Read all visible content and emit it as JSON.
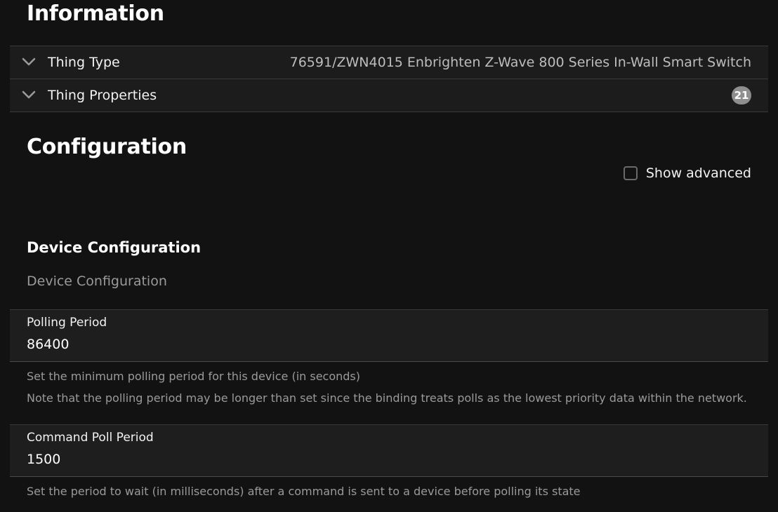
{
  "information": {
    "heading": "Information",
    "rows": [
      {
        "title": "Thing Type",
        "value": "76591/ZWN4015 Enbrighten Z-Wave 800 Series In-Wall Smart Switch",
        "icon": "chevron-down-icon"
      },
      {
        "title": "Thing Properties",
        "badge": "21",
        "icon": "chevron-down-icon"
      }
    ]
  },
  "configuration": {
    "heading": "Configuration",
    "show_advanced": {
      "label": "Show advanced",
      "checked": false
    }
  },
  "device_configuration": {
    "title": "Device Configuration",
    "description": "Device Configuration",
    "fields": [
      {
        "label": "Polling Period",
        "value": "86400",
        "help": [
          "Set the minimum polling period for this device (in seconds)",
          "Note that the polling period may be longer than set since the binding treats polls as the lowest priority data within the network."
        ]
      },
      {
        "label": "Command Poll Period",
        "value": "1500",
        "help": [
          "Set the period to wait (in milliseconds) after a command is sent to a device before polling its state"
        ]
      }
    ]
  }
}
